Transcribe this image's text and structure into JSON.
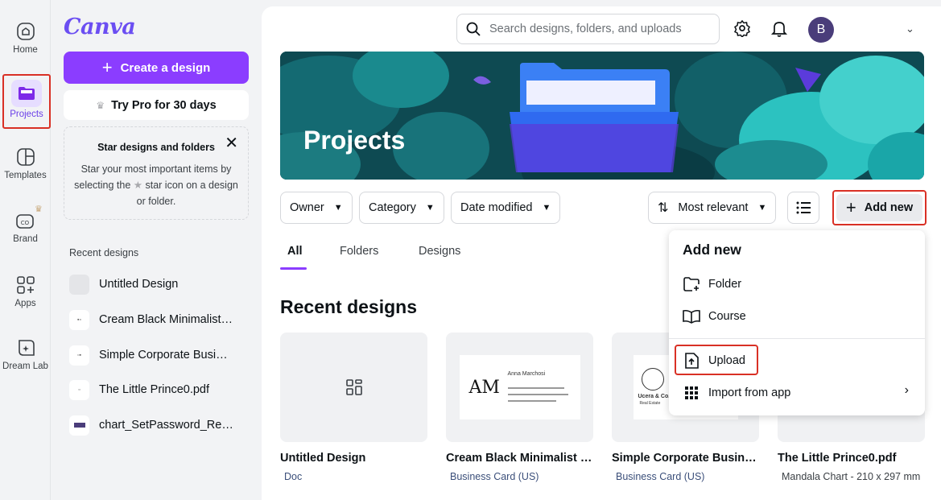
{
  "rail": {
    "home": "Home",
    "projects": "Projects",
    "templates": "Templates",
    "brand": "Brand",
    "apps": "Apps",
    "dreamlab": "Dream Lab"
  },
  "panel": {
    "logo": "Canva",
    "create_label": "Create a design",
    "pro_label": "Try Pro for 30 days",
    "tip": {
      "title": "Star designs and folders",
      "body_1": "Star your most important items by",
      "body_2a": "selecting the",
      "body_2b": "star icon on a design",
      "body_3": "or folder."
    },
    "recent_label": "Recent designs",
    "recent_items": [
      "Untitled Design",
      "Cream Black Minimalist…",
      "Simple Corporate Busi…",
      "The Little Prince0.pdf",
      "chart_SetPassword_Re…"
    ]
  },
  "header": {
    "search_placeholder": "Search designs, folders, and uploads",
    "avatar_initial": "B"
  },
  "banner": {
    "title": "Projects"
  },
  "filters": {
    "owner": "Owner",
    "category": "Category",
    "date": "Date modified",
    "sort": "Most relevant",
    "add_new": "Add new"
  },
  "tabs": [
    "All",
    "Folders",
    "Designs"
  ],
  "section_title": "Recent designs",
  "cards": [
    {
      "name": "Untitled Design",
      "sub": "Doc"
    },
    {
      "name": "Cream Black Minimalist …",
      "sub": "Business Card (US)",
      "logo": "AM",
      "person": "Anna Marchosi"
    },
    {
      "name": "Simple Corporate Busin…",
      "sub": "Business Card (US)",
      "brand": "Ucera & Co.",
      "brand_sub": "Real Estate"
    },
    {
      "name": "The Little Prince0.pdf",
      "sub": "Mandala Chart - 210 x 297 mm"
    }
  ],
  "dropdown": {
    "title": "Add new",
    "items": [
      "Folder",
      "Course",
      "Upload",
      "Import from app"
    ]
  },
  "colors": {
    "accent": "#8b3dff",
    "highlight": "#d93025",
    "banner_bg": "#0e4a52"
  }
}
